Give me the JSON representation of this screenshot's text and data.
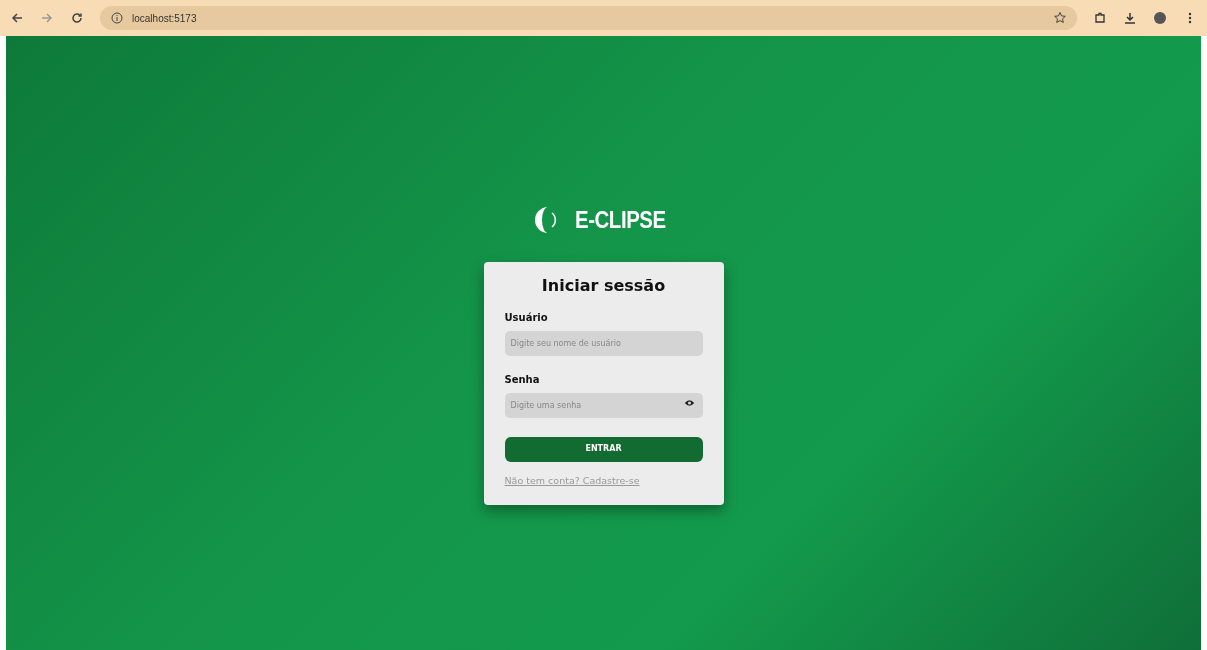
{
  "browser": {
    "address": "localhost:5173"
  },
  "logo": {
    "text": "E-CLIPSE"
  },
  "login": {
    "title": "Iniciar sessão",
    "fields": [
      {
        "label": "Usuário",
        "placeholder": "Digite seu nome de usuário",
        "kind": "text"
      },
      {
        "label": "Senha",
        "placeholder": "Digite uma senha",
        "kind": "password"
      }
    ],
    "submit": "ENTRAR",
    "signup_link": "Não tem conta? Cadastre-se"
  }
}
